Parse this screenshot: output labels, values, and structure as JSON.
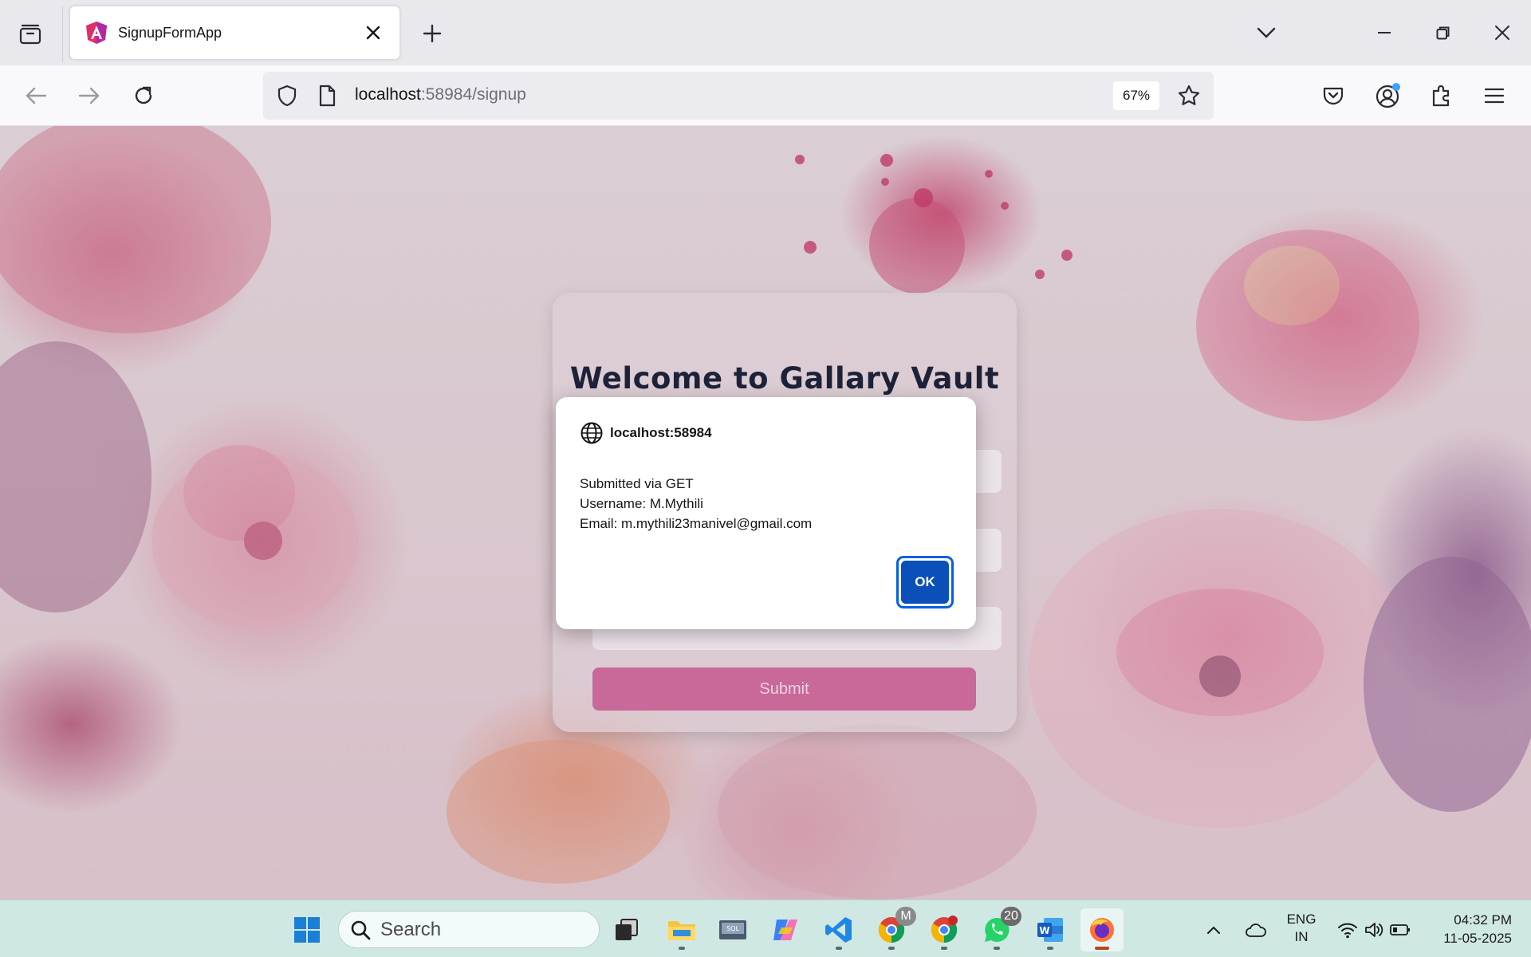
{
  "browser": {
    "tab_title": "SignupFormApp",
    "url_host": "localhost",
    "url_rest": ":58984/signup",
    "zoom": "67%"
  },
  "page": {
    "title": "Welcome to Gallary Vault",
    "submit_label": "Submit"
  },
  "dialog": {
    "origin": "localhost:58984",
    "line1": "Submitted via GET",
    "line2": "Username: M.Mythili",
    "line3": "Email: m.mythili23manivel@gmail.com",
    "ok_label": "OK"
  },
  "taskbar": {
    "search_label": "Search",
    "whatsapp_badge": "20",
    "chrome_profile_badge": "M",
    "language_line1": "ENG",
    "language_line2": "IN",
    "time": "04:32 PM",
    "date": "11-05-2025"
  },
  "colors": {
    "accent": "#0b4fb8",
    "submit_button": "#c9699a",
    "taskbar": "#cfe8e4"
  }
}
